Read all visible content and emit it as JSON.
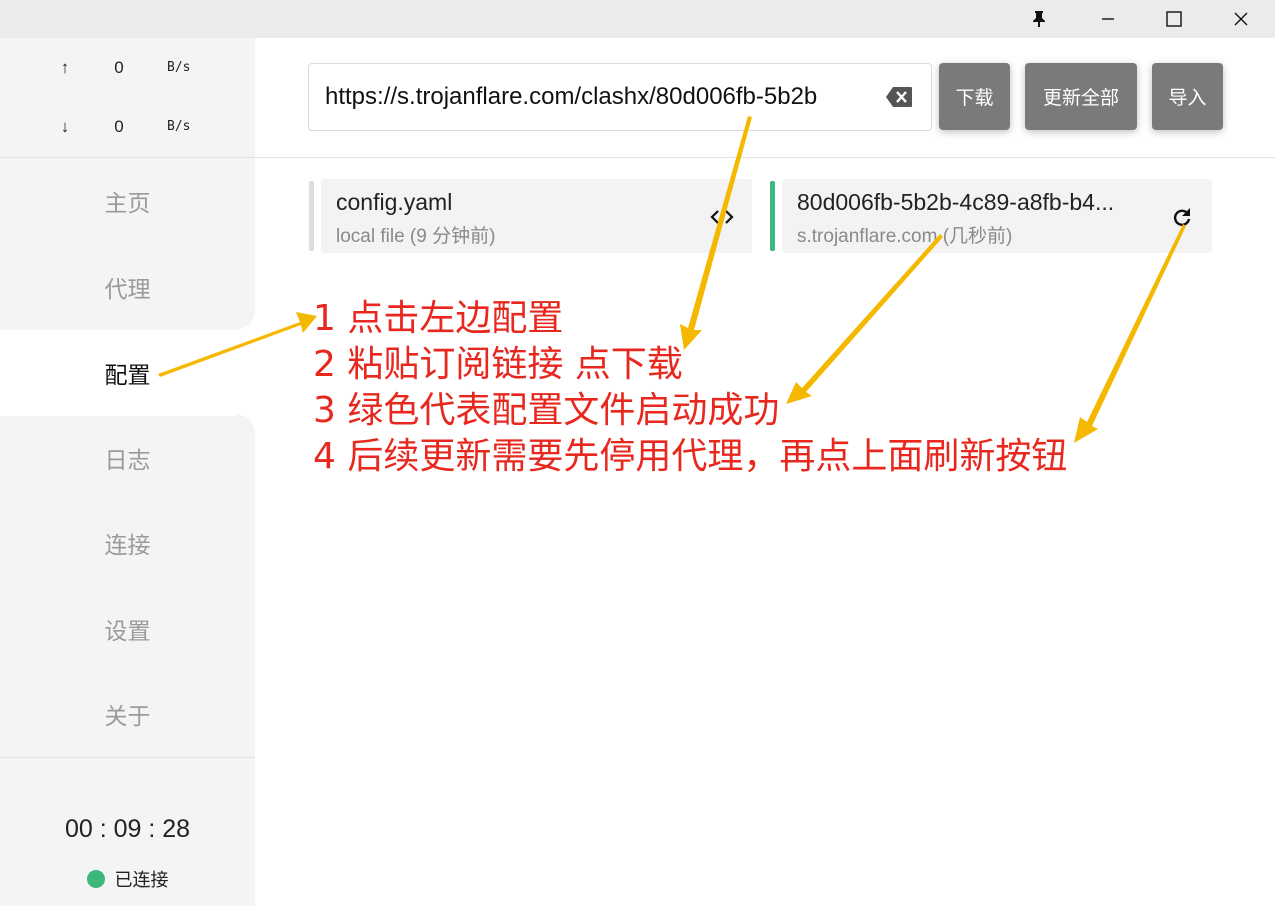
{
  "window": {
    "controls": [
      "pin-icon",
      "minimize-icon",
      "maximize-icon",
      "close-icon"
    ]
  },
  "traffic": {
    "up_arrow": "↑",
    "up_value": "0",
    "up_unit": "B/s",
    "down_arrow": "↓",
    "down_value": "0",
    "down_unit": "B/s"
  },
  "sidebar": {
    "items": [
      {
        "label": "主页",
        "active": false
      },
      {
        "label": "代理",
        "active": false
      },
      {
        "label": "配置",
        "active": true
      },
      {
        "label": "日志",
        "active": false
      },
      {
        "label": "连接",
        "active": false
      },
      {
        "label": "设置",
        "active": false
      },
      {
        "label": "关于",
        "active": false
      }
    ]
  },
  "status": {
    "timer": "00 : 09 : 28",
    "connection": "已连接",
    "connection_color": "#3cb87b"
  },
  "toolbar": {
    "url_value": "https://s.trojanflare.com/clashx/80d006fb-5b2b",
    "download_label": "下载",
    "update_all_label": "更新全部",
    "import_label": "导入",
    "button_color": "#7a7a7a"
  },
  "profiles": [
    {
      "title": "config.yaml",
      "subtitle": "local file (9 分钟前)",
      "indicator_color": "#dddddd",
      "icon": "code-icon"
    },
    {
      "title": "80d006fb-5b2b-4c89-a8fb-b4...",
      "subtitle": "s.trojanflare.com (几秒前)",
      "indicator_color": "#3cb87b",
      "icon": "refresh-icon"
    }
  ],
  "annotations": {
    "line1": "1 点击左边配置",
    "line2": "2 粘贴订阅链接 点下载",
    "line3": "3 绿色代表配置文件启动成功",
    "line4": "4 后续更新需要先停用代理，再点上面刷新按钮",
    "text_color": "#e8281e",
    "arrow_color": "#f5b800"
  }
}
